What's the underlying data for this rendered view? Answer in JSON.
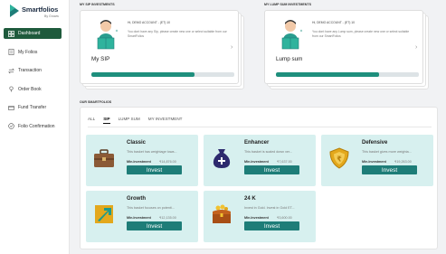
{
  "brand": {
    "name": "Smartfolios",
    "sub": "By Groww"
  },
  "sidebar": {
    "items": [
      {
        "label": "Dashboard",
        "icon": "dashboard-icon",
        "active": true
      },
      {
        "label": "My Folios",
        "icon": "folio-icon"
      },
      {
        "label": "Transaction",
        "icon": "transaction-icon"
      },
      {
        "label": "Order Book",
        "icon": "order-book-icon"
      },
      {
        "label": "Fund Transfer",
        "icon": "fund-transfer-icon"
      },
      {
        "label": "Folio Confirmation",
        "icon": "confirmation-icon"
      }
    ]
  },
  "sip_section": {
    "label": "MY SIP INVESTMENTS",
    "card": {
      "title": "My SIP",
      "account": "Hi, DEMO ACCOUNT - (ET) 10",
      "message": "You dont have any Sip, please create new one or select suitable from our SmartFolios",
      "progress": 0.72
    }
  },
  "lumpsum_section": {
    "label": "MY LUMP SUM INVESTMENTS",
    "card": {
      "title": "Lump sum",
      "account": "Hi, DEMO ACCOUNT - (ET) 10",
      "message": "You dont have any Lump sum, please create new one or select suitable from our SmartFolios",
      "progress": 0.72
    }
  },
  "smartfolios": {
    "label": "OUR SMARTFOLIOS",
    "tabs": [
      "ALL",
      "SIP",
      "LUMP SUM",
      "MY INVESTMENT"
    ],
    "active_tab": "SIP",
    "items": [
      {
        "title": "Classic",
        "desc": "This basket has weightage towa...",
        "min_label": "Min.Investment",
        "amount": "₹14,876.00",
        "button": "Invest",
        "icon": "briefcase-icon"
      },
      {
        "title": "Enhancer",
        "desc": "This basket is scaled down ver...",
        "min_label": "Min.Investment",
        "amount": "₹7,637.00",
        "button": "Invest",
        "icon": "money-bag-icon"
      },
      {
        "title": "Defensive",
        "desc": "This basket gives more weighta...",
        "min_label": "Min.Investment",
        "amount": "₹19,263.00",
        "button": "Invest",
        "icon": "shield-icon"
      },
      {
        "title": "Growth",
        "desc": "This basket focuses on potenti...",
        "min_label": "Min.Investment",
        "amount": "₹12,135.00",
        "button": "Invest",
        "icon": "growth-arrow-icon"
      },
      {
        "title": "24 K",
        "desc": "Invest in Gold. Invest in Gold ET...",
        "min_label": "Min.Investment",
        "amount": "₹3,600.00",
        "button": "Invest",
        "icon": "treasure-chest-icon"
      }
    ]
  },
  "colors": {
    "primary": "#1e5a3c",
    "accent": "#1e7d78",
    "card_bg": "#d7f0ef",
    "progress": "#1e8f7d"
  }
}
